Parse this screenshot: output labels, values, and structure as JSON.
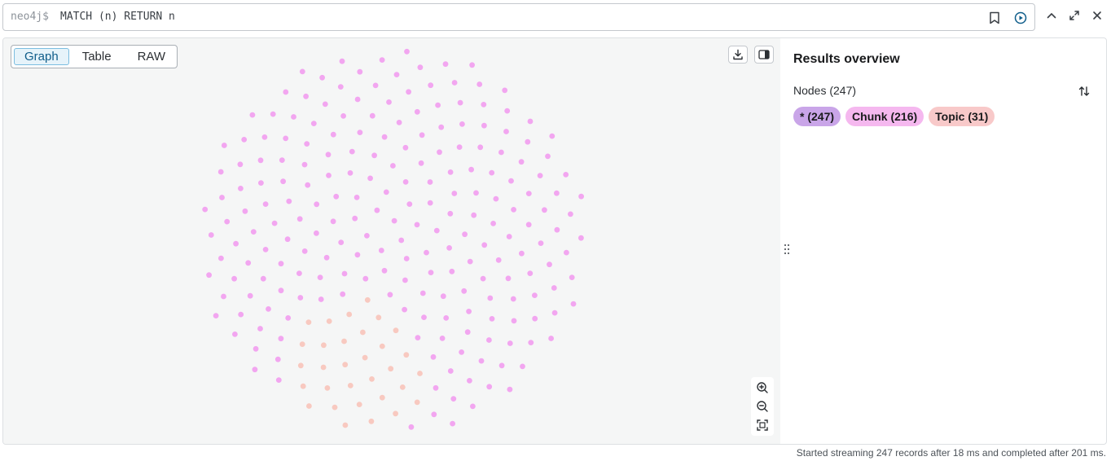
{
  "query": {
    "prompt": "neo4j$",
    "text": "MATCH (n) RETURN n"
  },
  "view_tabs": [
    {
      "label": "Graph",
      "active": true
    },
    {
      "label": "Table",
      "active": false
    },
    {
      "label": "RAW",
      "active": false
    }
  ],
  "overview": {
    "title": "Results overview",
    "nodes_label": "Nodes (247)",
    "labels": [
      {
        "text": "* (247)",
        "color": "#c9a5e8"
      },
      {
        "text": "Chunk (216)",
        "color": "#f5b8ef"
      },
      {
        "text": "Topic (31)",
        "color": "#f8c9c9"
      }
    ]
  },
  "graph": {
    "node_count": 247,
    "chunk_count": 216,
    "topic_count": 31,
    "chunk_color": "#f2a6f0",
    "topic_color": "#f8c9c0",
    "background": "#f5f6f6"
  },
  "status": "Started streaming 247 records after 18 ms and completed after 201 ms.",
  "colors": {
    "accent": "#0f5d8a",
    "border": "#c4c8cd"
  }
}
